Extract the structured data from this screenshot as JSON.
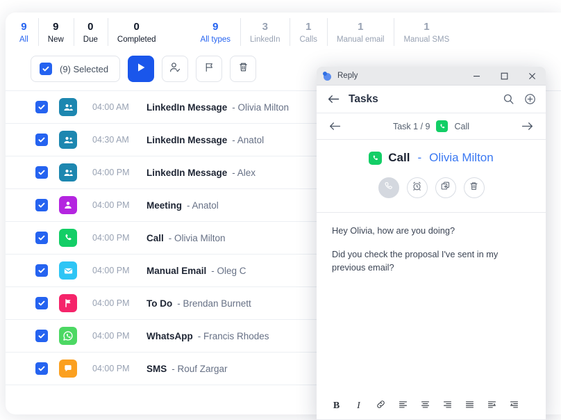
{
  "tabs_status": [
    {
      "num": "9",
      "label": "All",
      "state": "active"
    },
    {
      "num": "9",
      "label": "New",
      "state": "normal"
    },
    {
      "num": "0",
      "label": "Due",
      "state": "normal"
    },
    {
      "num": "0",
      "label": "Completed",
      "state": "normal"
    }
  ],
  "tabs_types": [
    {
      "num": "9",
      "label": "All types",
      "state": "active"
    },
    {
      "num": "3",
      "label": "LinkedIn",
      "state": "muted"
    },
    {
      "num": "1",
      "label": "Calls",
      "state": "muted"
    },
    {
      "num": "1",
      "label": "Manual email",
      "state": "muted"
    },
    {
      "num": "1",
      "label": "Manual SMS",
      "state": "muted"
    }
  ],
  "toolbar": {
    "selected_label": "(9) Selected",
    "play_icon": "play-icon",
    "assign_icon": "person-check-icon",
    "flag_icon": "flag-icon",
    "delete_icon": "trash-icon"
  },
  "tasks": [
    {
      "time": "04:00 AM",
      "title": "LinkedIn Message",
      "who": "- Olivia Milton",
      "icon": "linkedin-people-icon",
      "color": "#1d87b0"
    },
    {
      "time": "04:30 AM",
      "title": "LinkedIn Message",
      "who": "- Anatol",
      "icon": "linkedin-people-icon",
      "color": "#1d87b0"
    },
    {
      "time": "04:00 PM",
      "title": "LinkedIn Message",
      "who": "- Alex",
      "icon": "linkedin-people-icon",
      "color": "#1d87b0"
    },
    {
      "time": "04:00 PM",
      "title": "Meeting",
      "who": "- Anatol",
      "icon": "person-icon",
      "color": "#b425e0"
    },
    {
      "time": "04:00 PM",
      "title": "Call",
      "who": "- Olivia Milton",
      "icon": "phone-icon",
      "color": "#13ce66"
    },
    {
      "time": "04:00 PM",
      "title": "Manual Email",
      "who": "- Oleg C",
      "icon": "envelope-icon",
      "color": "#2ec5f5"
    },
    {
      "time": "04:00 PM",
      "title": "To Do",
      "who": "- Brendan Burnett",
      "icon": "flag-icon",
      "color": "#f5246a"
    },
    {
      "time": "04:00 PM",
      "title": "WhatsApp",
      "who": "- Francis Rhodes",
      "icon": "whatsapp-icon",
      "color": "#4cd863"
    },
    {
      "time": "04:00 PM",
      "title": "SMS",
      "who": "- Rouf Zargar",
      "icon": "sms-bubble-icon",
      "color": "#fba020"
    }
  ],
  "window": {
    "app_title": "Reply",
    "minimize_icon": "minimize-icon",
    "maximize_icon": "maximize-icon",
    "close_icon": "close-icon",
    "header_title": "Tasks",
    "back_icon": "arrow-left-icon",
    "search_icon": "search-icon",
    "add_icon": "plus-circle-icon",
    "nav": {
      "prev_icon": "arrow-left-icon",
      "next_icon": "arrow-right-icon",
      "counter": "Task 1 / 9",
      "type_label": "Call",
      "type_icon": "phone-icon"
    },
    "task": {
      "type_icon": "phone-icon",
      "type": "Call",
      "dash": "-",
      "contact": "Olivia Milton"
    },
    "actions": [
      {
        "name": "call-action-button",
        "icon": "phone-icon"
      },
      {
        "name": "snooze-action-button",
        "icon": "alarm-clock-icon"
      },
      {
        "name": "duplicate-action-button",
        "icon": "copy-plus-icon"
      },
      {
        "name": "delete-action-button",
        "icon": "trash-icon"
      }
    ],
    "message": {
      "line1": "Hey Olivia, how are you doing?",
      "line2": "Did you check the proposal I've sent in my previous email?"
    },
    "format_buttons": [
      {
        "name": "bold-button",
        "glyph": "B"
      },
      {
        "name": "italic-button",
        "glyph": "I"
      },
      {
        "name": "link-button",
        "glyph": "link-icon"
      },
      {
        "name": "align-left-button",
        "glyph": "align-left-icon"
      },
      {
        "name": "align-center-button",
        "glyph": "align-center-icon"
      },
      {
        "name": "align-right-button",
        "glyph": "align-right-icon"
      },
      {
        "name": "align-justify-button",
        "glyph": "align-justify-icon"
      },
      {
        "name": "indent-button",
        "glyph": "indent-icon"
      },
      {
        "name": "outdent-button",
        "glyph": "outdent-icon"
      }
    ]
  },
  "colors": {
    "accent": "#2563f0",
    "active_tab": "#2563f0",
    "link": "#3a78f2"
  }
}
